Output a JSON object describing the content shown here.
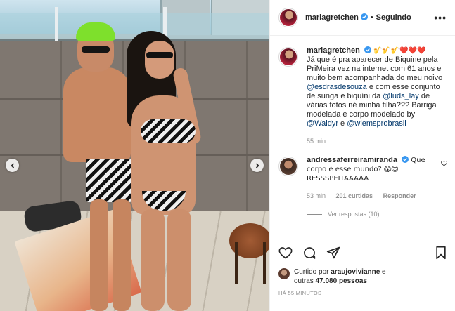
{
  "post": {
    "username": "mariagretchen",
    "follow_status": "Seguindo",
    "more_label": "•••",
    "caption": {
      "author": "mariagretchen",
      "emojis": "🎷🎷🎷❤️❤️❤️",
      "text_1": "Já que é pra aparecer de Biquine pela PriMeira vez na internet com 61 anos e muito bem acompanhada do meu noivo ",
      "mention_1": "@esdrasdesouza",
      "text_2": " e com esse conjunto de sunga e biquíni da ",
      "mention_2": "@luds_lay",
      "text_3": " de várias fotos né minha filha??? Barriga modelada e corpo modelado by ",
      "mention_3": "@Waldyr",
      "text_4": " e ",
      "mention_4": "@wiemsprobrasil",
      "time": "55 min"
    },
    "comments": [
      {
        "author": "andressaferreiramiranda",
        "text": " Que corpo é esse mundo? 😱😍 RESSSPEITAAAAA",
        "time": "53 min",
        "likes": "201 curtidas",
        "reply": "Responder",
        "view_replies": "Ver respostas (10)"
      }
    ],
    "likes": {
      "prefix": "Curtido por",
      "user": "araujovivianne",
      "middle": " e",
      "suffix_prefix": "outras",
      "count": "47.080 pessoas"
    },
    "posted_ago": "HÁ 55 MINUTOS"
  },
  "icons": {
    "like": "heart-icon",
    "comment": "comment-icon",
    "share": "share-icon",
    "save": "bookmark-icon",
    "prev": "chevron-left-icon",
    "next": "chevron-right-icon",
    "verified": "verified-badge-icon"
  },
  "colors": {
    "verified_blue": "#3897f0",
    "mention": "#00376b",
    "muted": "#8e8e8e"
  }
}
